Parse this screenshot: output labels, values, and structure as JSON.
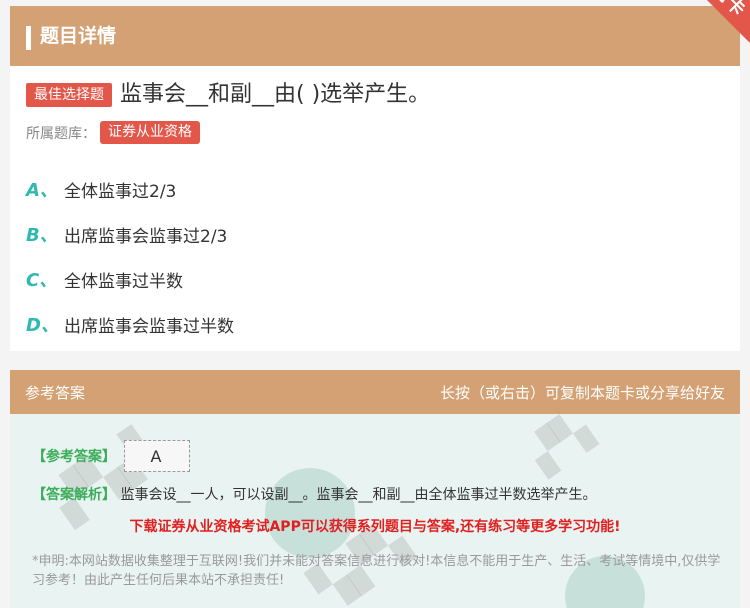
{
  "header": {
    "title": "题目详情",
    "corner_ribbon": "题卡"
  },
  "question": {
    "type_badge": "最佳选择题",
    "text": "监事会__和副__由( )选举产生。",
    "bank_label": "所属题库：",
    "bank_name": "证券从业资格"
  },
  "options": [
    {
      "letter": "A、",
      "text": "全体监事过2/3"
    },
    {
      "letter": "B、",
      "text": "出席监事会监事过2/3"
    },
    {
      "letter": "C、",
      "text": "全体监事过半数"
    },
    {
      "letter": "D、",
      "text": "出席监事会监事过半数"
    }
  ],
  "answer_section": {
    "title": "参考答案",
    "hint": "长按（或右击）可复制本题卡或分享给好友",
    "answer_label": "【参考答案】",
    "answer_value": "A",
    "analysis_label": "【答案解析】",
    "analysis_text": "监事会设__一人，可以设副__。监事会__和副__由全体监事过半数选举产生。",
    "promo": "下载证券从业资格考试APP可以获得系列题目与答案,还有练习等更多学习功能!",
    "disclaimer": "*申明:本网站数据收集整理于互联网!我们并未能对答案信息进行核对!本信息不能用于生产、生活、考试等情境中,仅供学习参考！由此产生任何后果本站不承担责任!"
  },
  "colors": {
    "header_bg": "#d3a173",
    "badge_red": "#e3574a",
    "option_letter": "#2fb9b1",
    "answer_green": "#3cae5b",
    "promo_red": "#e02020"
  }
}
